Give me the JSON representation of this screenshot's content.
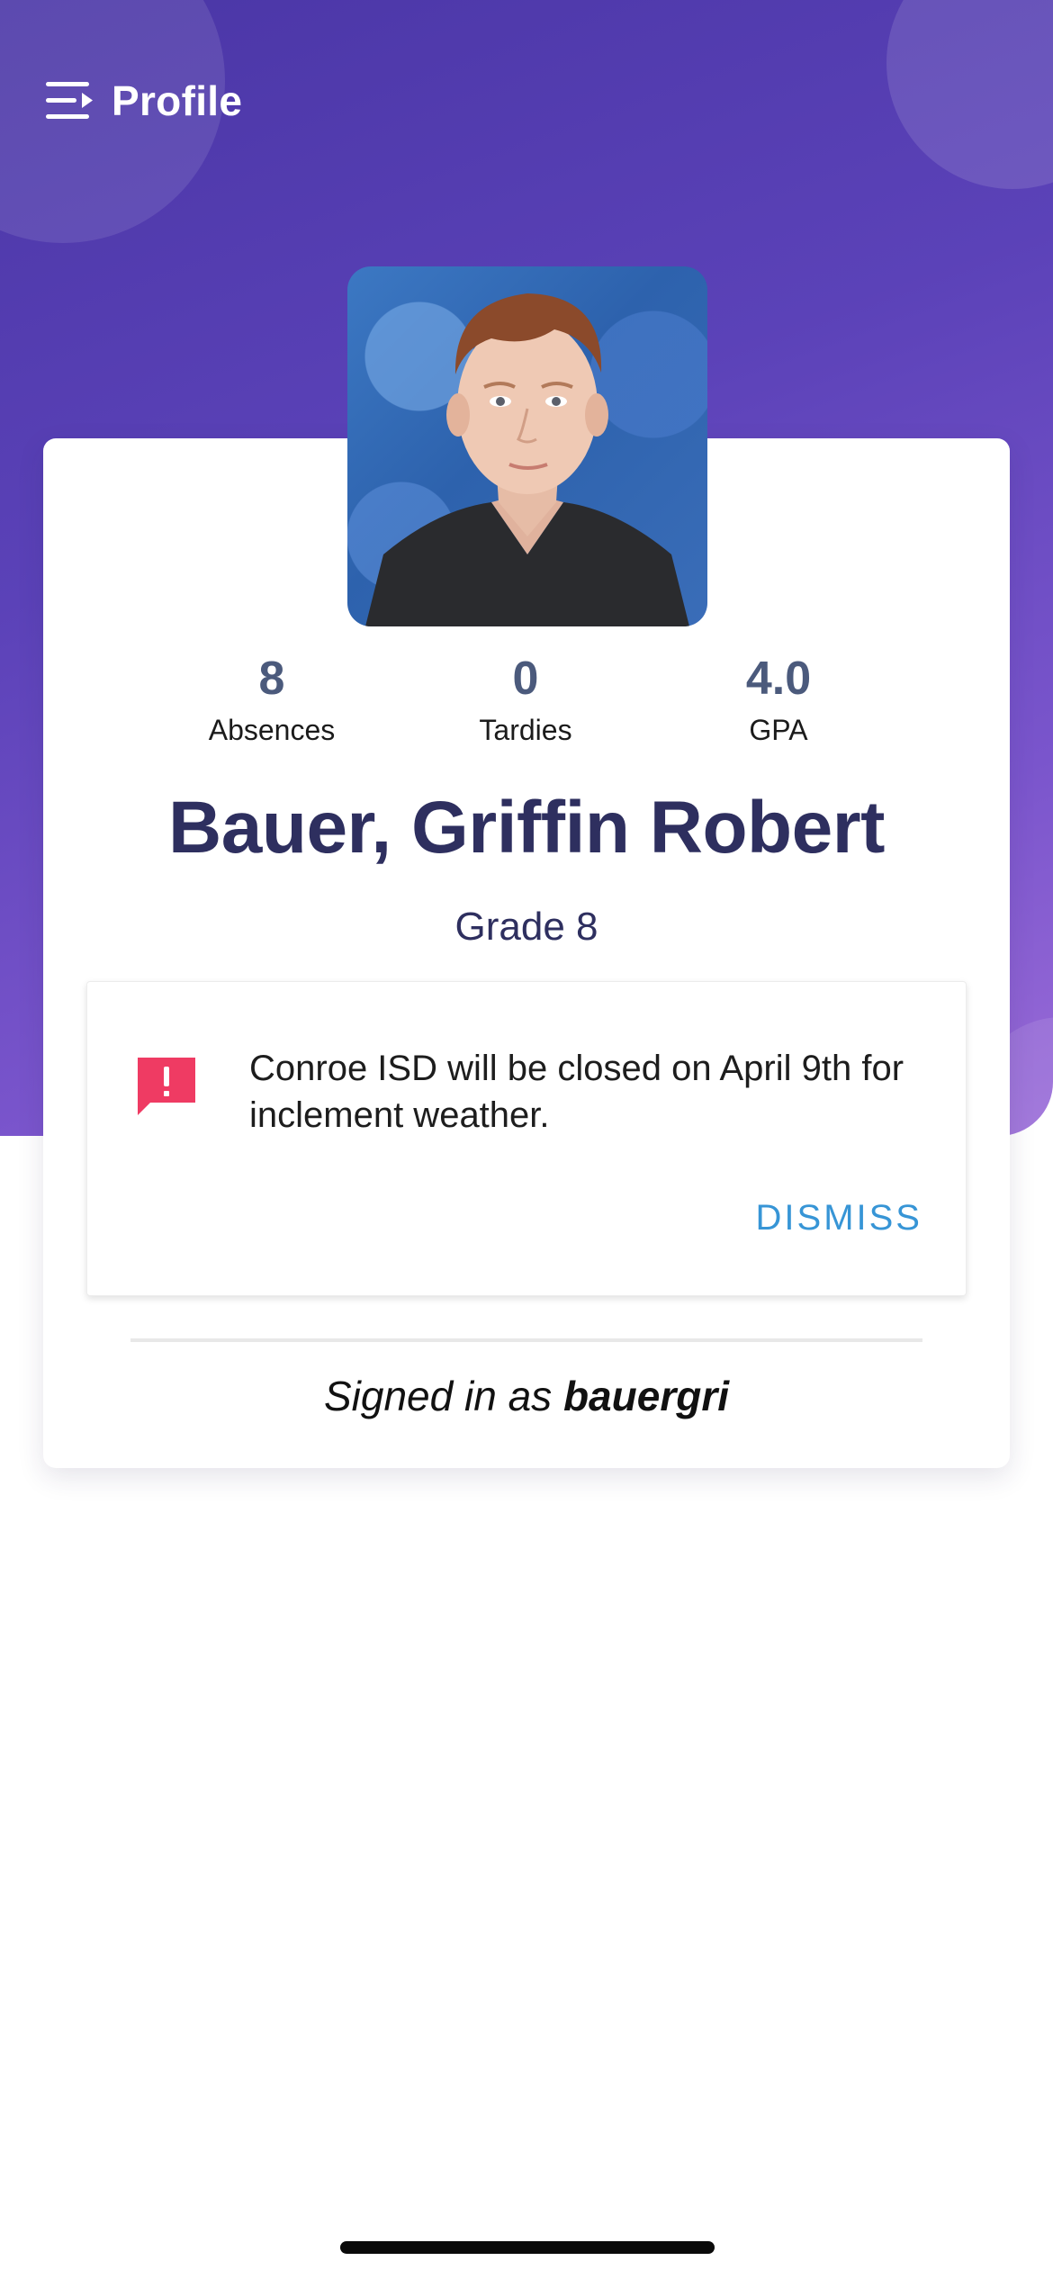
{
  "header": {
    "title": "Profile",
    "menu_icon": "menu-collapse-icon"
  },
  "student": {
    "photo": "student-photo",
    "name": "Bauer, Griffin Robert",
    "grade": "Grade 8"
  },
  "stats": [
    {
      "value": "8",
      "label": "Absences"
    },
    {
      "value": "0",
      "label": "Tardies"
    },
    {
      "value": "4.0",
      "label": "GPA"
    }
  ],
  "alert": {
    "icon": "alert-message-icon",
    "message": "Conroe ISD will be closed on April 9th for inclement weather.",
    "dismiss_label": "DISMISS"
  },
  "account": {
    "signed_in_prefix": "Signed in as",
    "username": "bauergri"
  },
  "colors": {
    "header_gradient_start": "#4a36a6",
    "header_gradient_end": "#9a6bd8",
    "name_text": "#2e2f5f",
    "stat_number": "#4b5a7c",
    "alert_icon": "#ef3b63",
    "dismiss_text": "#3795d6"
  }
}
